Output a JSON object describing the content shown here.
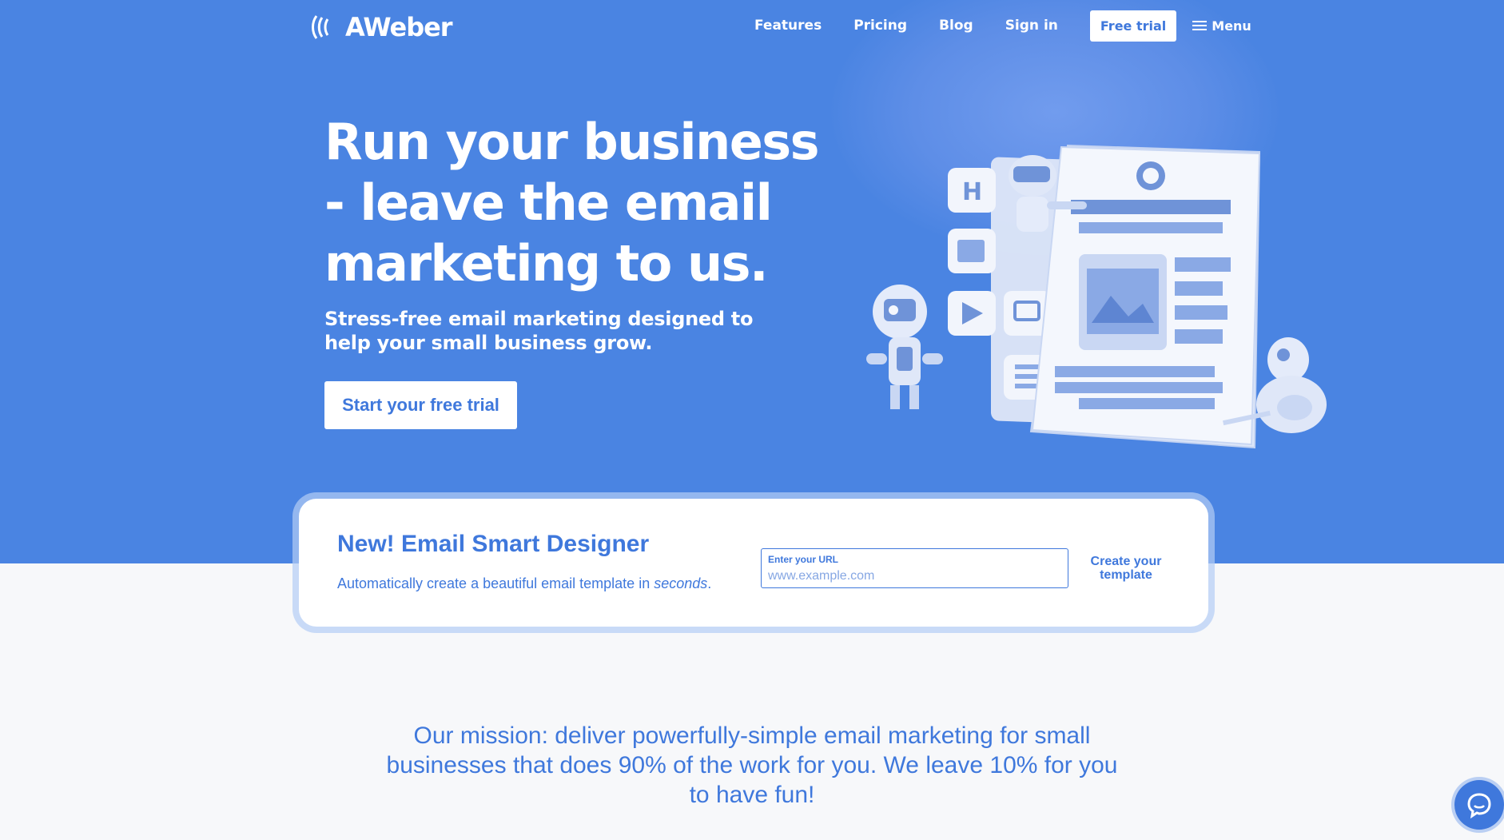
{
  "brand": {
    "name": "AWeber"
  },
  "nav": {
    "links": [
      "Features",
      "Pricing",
      "Blog",
      "Sign in"
    ],
    "cta": "Free trial",
    "menu_label": "Menu"
  },
  "hero": {
    "headline": "Run your business - leave the email marketing to us.",
    "subhead": "Stress-free email marketing designed to help your small business grow.",
    "cta": "Start your free trial"
  },
  "smart_designer": {
    "title": "New! Email Smart Designer",
    "subtitle_prefix": "Automatically create a beautiful email template in ",
    "subtitle_emphasis": "seconds",
    "subtitle_suffix": ".",
    "url_label": "Enter your URL",
    "url_placeholder": "www.example.com",
    "button": "Create your template"
  },
  "mission": {
    "text": "Our mission: deliver powerfully-simple email marketing for small businesses that does 90% of the work for you. We leave 10% for you to have fun!"
  },
  "colors": {
    "hero_bg": "#4a84e2",
    "accent": "#3f78dc",
    "page_bg": "#f7f8fa"
  },
  "icons": {
    "logo": "aweber-wave-icon",
    "menu": "hamburger-icon",
    "chat": "chat-bubble-icon"
  }
}
